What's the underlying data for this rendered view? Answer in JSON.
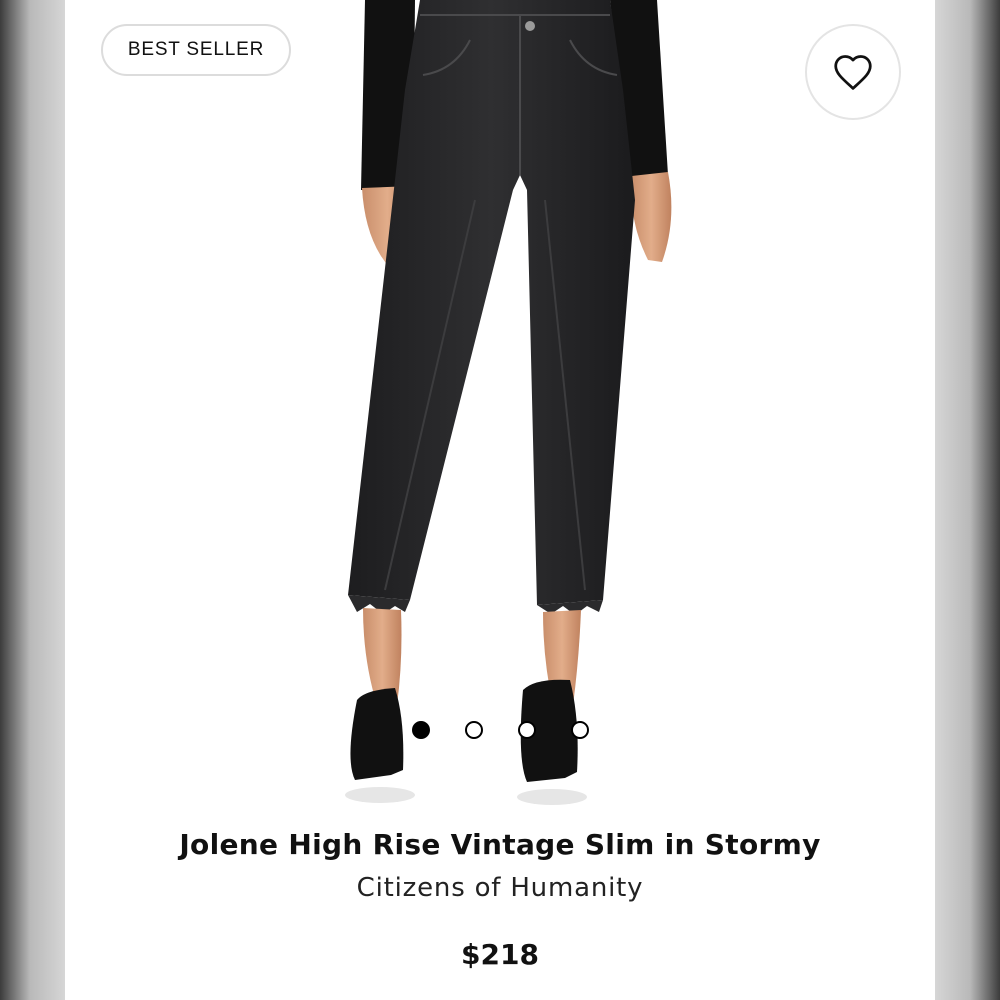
{
  "badge": {
    "label": "BEST SELLER"
  },
  "favorite": {
    "icon": "heart-outline-icon"
  },
  "product": {
    "title": "Jolene High Rise Vintage Slim in Stormy",
    "brand": "Citizens of Humanity",
    "price": "$218"
  },
  "carousel": {
    "total_images": 4,
    "active_index": 0
  }
}
